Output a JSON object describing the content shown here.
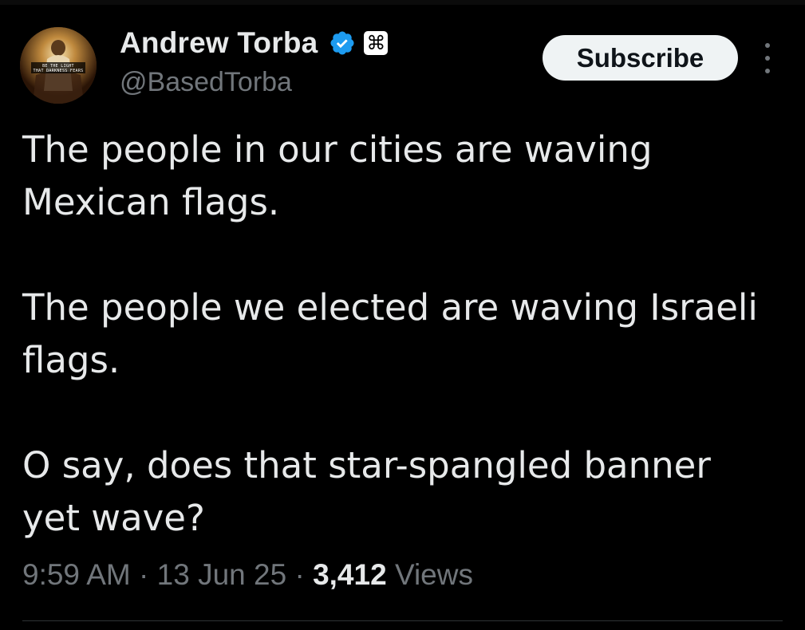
{
  "author": {
    "display_name": "Andrew Torba",
    "handle": "@BasedTorba",
    "avatar_caption_line1": "BE THE LIGHT",
    "avatar_caption_line2": "THAT DARKNESS FEARS",
    "verified_icon": "verified-badge-icon",
    "affiliate_icon": "command-key-icon",
    "affiliate_glyph": "⌘"
  },
  "actions": {
    "subscribe_label": "Subscribe",
    "more_icon": "more-vertical-icon"
  },
  "tweet": {
    "paragraphs": [
      "The people in our cities are waving\nMexican flags.",
      "The people we elected are waving Israeli\nflags.",
      "O say, does that star-spangled banner\nyet wave?"
    ]
  },
  "meta": {
    "time": "9:59 AM",
    "separator": "·",
    "date": "13 Jun 25",
    "views_count": "3,412",
    "views_label": "Views"
  },
  "colors": {
    "background": "#000000",
    "primary_text": "#e7e9ea",
    "secondary_text": "#71767b",
    "verified_blue": "#1d9bf0",
    "button_bg": "#eff3f4"
  }
}
